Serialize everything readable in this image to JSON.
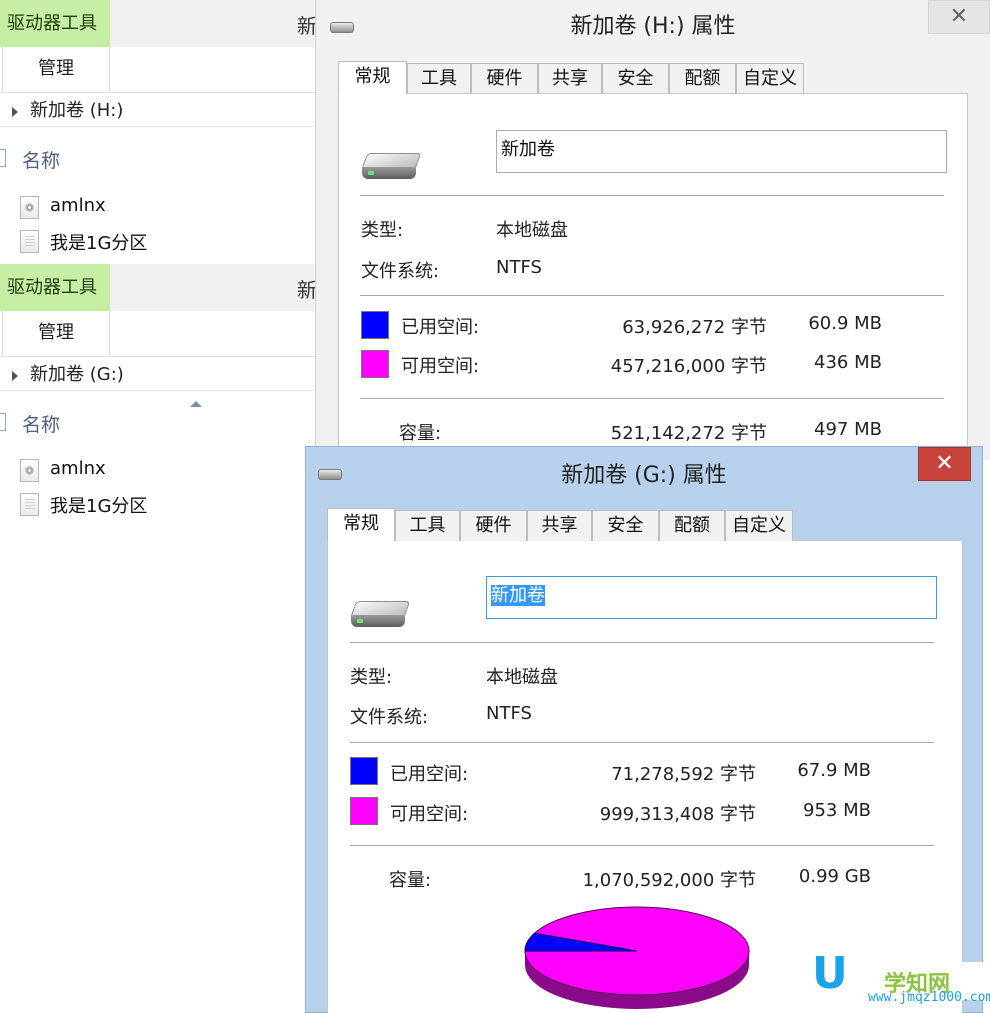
{
  "explorer_h": {
    "ribbon_tab": "驱动器工具",
    "title_partial": "新",
    "manage": "管理",
    "address": "新加卷 (H:)",
    "column": "名称",
    "files": [
      {
        "name": "amlnx",
        "icon": "disc-image-file-icon"
      },
      {
        "name": "我是1G分区",
        "icon": "text-file-icon"
      }
    ]
  },
  "explorer_g": {
    "ribbon_tab": "驱动器工具",
    "title_partial": "新",
    "manage": "管理",
    "address": "新加卷 (G:)",
    "column": "名称",
    "files": [
      {
        "name": "amlnx",
        "icon": "disc-image-file-icon"
      },
      {
        "name": "我是1G分区",
        "icon": "text-file-icon"
      }
    ]
  },
  "dialog_h": {
    "title": "新加卷 (H:) 属性",
    "close": "✕",
    "tabs": [
      "常规",
      "工具",
      "硬件",
      "共享",
      "安全",
      "配额",
      "自定义"
    ],
    "active_tab": "常规",
    "volume_name": "新加卷",
    "type_label": "类型:",
    "type_value": "本地磁盘",
    "fs_label": "文件系统:",
    "fs_value": "NTFS",
    "used_label": "已用空间:",
    "used_bytes": "63,926,272 字节",
    "used_size": "60.9 MB",
    "free_label": "可用空间:",
    "free_bytes": "457,216,000 字节",
    "free_size": "436 MB",
    "capacity_label": "容量:",
    "capacity_bytes": "521,142,272 字节",
    "capacity_size": "497 MB",
    "used_color": "#0000ff",
    "free_color": "#ff00ff"
  },
  "dialog_g": {
    "title": "新加卷 (G:) 属性",
    "close": "✕",
    "tabs": [
      "常规",
      "工具",
      "硬件",
      "共享",
      "安全",
      "配额",
      "自定义"
    ],
    "active_tab": "常规",
    "volume_name": "新加卷",
    "type_label": "类型:",
    "type_value": "本地磁盘",
    "fs_label": "文件系统:",
    "fs_value": "NTFS",
    "used_label": "已用空间:",
    "used_bytes": "71,278,592 字节",
    "used_size": "67.9 MB",
    "free_label": "可用空间:",
    "free_bytes": "999,313,408 字节",
    "free_size": "953 MB",
    "capacity_label": "容量:",
    "capacity_bytes": "1,070,592,000 字节",
    "capacity_size": "0.99 GB",
    "used_color": "#0000ff",
    "free_color": "#ff00ff",
    "used_fraction": 0.0666
  },
  "watermark": {
    "logo_letter": "U",
    "site_name": "学知网",
    "url": "www.jmqz1000.com"
  }
}
